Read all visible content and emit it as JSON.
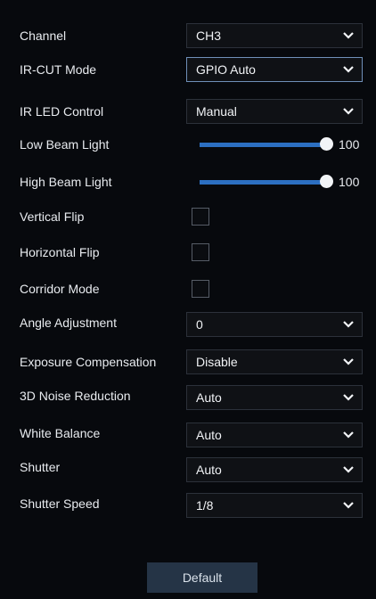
{
  "settings": {
    "channel": {
      "label": "Channel",
      "value": "CH3"
    },
    "ir_cut_mode": {
      "label": "IR-CUT Mode",
      "value": "GPIO Auto"
    },
    "ir_led_control": {
      "label": "IR LED Control",
      "value": "Manual"
    },
    "low_beam_light": {
      "label": "Low Beam Light",
      "value": "100",
      "level": 1.0
    },
    "high_beam_light": {
      "label": "High Beam Light",
      "value": "100",
      "level": 1.0
    },
    "vertical_flip": {
      "label": "Vertical Flip",
      "checked": false
    },
    "horizontal_flip": {
      "label": "Horizontal Flip",
      "checked": false
    },
    "corridor_mode": {
      "label": "Corridor Mode",
      "checked": false
    },
    "angle_adjustment": {
      "label": "Angle Adjustment",
      "value": "0"
    },
    "exposure_compensation": {
      "label": "Exposure Compensation",
      "value": "Disable"
    },
    "noise_reduction_3d": {
      "label": "3D Noise Reduction",
      "value": "Auto"
    },
    "white_balance": {
      "label": "White Balance",
      "value": "Auto"
    },
    "shutter": {
      "label": "Shutter",
      "value": "Auto"
    },
    "shutter_speed": {
      "label": "Shutter Speed",
      "value": "1/8"
    }
  },
  "footer": {
    "default_label": "Default"
  },
  "icons": {
    "dropdown": "chevron-down-icon"
  },
  "colors": {
    "background": "#07090d",
    "slider_track": "#1f4f8c",
    "slider_fill": "#2c6fc1",
    "button_bg": "#253446"
  }
}
